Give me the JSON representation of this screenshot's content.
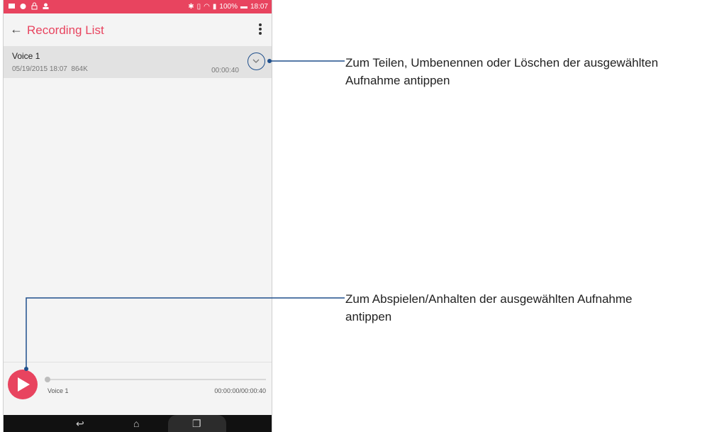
{
  "app": {
    "title": "Recording List",
    "status_time": "18:07",
    "battery": "100%"
  },
  "recordings": [
    {
      "name": "Voice 1",
      "date": "05/19/2015 18:07",
      "size": "864K",
      "duration": "00:00:40"
    }
  ],
  "player": {
    "track_name": "Voice 1",
    "time": "00:00:00/00:00:40",
    "progress": 0
  },
  "annotations": {
    "menu_action": "Zum Teilen, Umbenennen oder Löschen der ausgewählten Aufnahme antippen",
    "play_action": "Zum Abspielen/Anhalten der ausgewählten Aufnahme antippen"
  },
  "colors": {
    "accent": "#e8445f",
    "callout": "#1f4f8b"
  }
}
